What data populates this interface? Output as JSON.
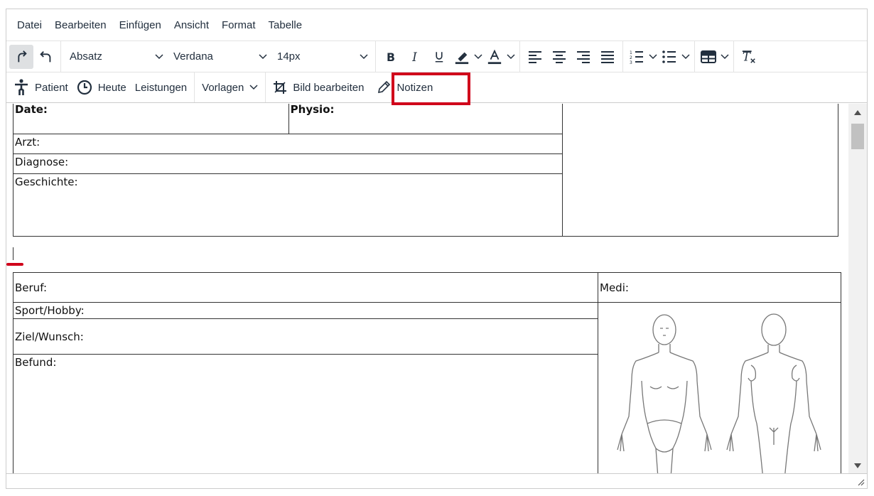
{
  "menubar": {
    "items": [
      "Datei",
      "Bearbeiten",
      "Einfügen",
      "Ansicht",
      "Format",
      "Tabelle"
    ]
  },
  "toolbar1": {
    "block_format": "Absatz",
    "font_family": "Verdana",
    "font_size": "14px",
    "icons": [
      "redo-icon",
      "undo-icon",
      "bold-icon",
      "italic-icon",
      "underline-icon",
      "highlight-icon",
      "text-color-icon",
      "align-left-icon",
      "align-center-icon",
      "align-right-icon",
      "justify-icon",
      "numbered-list-icon",
      "bullet-list-icon",
      "table-icon",
      "clear-format-icon"
    ]
  },
  "toolbar2": {
    "patient": "Patient",
    "heute": "Heute",
    "leistungen": "Leistungen",
    "vorlagen": "Vorlagen",
    "bild_bearbeiten": "Bild bearbeiten",
    "notizen": "Notizen"
  },
  "highlight_color": "#d0021b",
  "document": {
    "table1": {
      "date": "Date:",
      "physio": "Physio:",
      "arzt": "Arzt:",
      "diagnose": "Diagnose:",
      "geschichte": "Geschichte:"
    },
    "table2": {
      "beruf": "Beruf:",
      "medi": "Medi:",
      "sport": "Sport/Hobby:",
      "ziel": "Ziel/Wunsch:",
      "befund": "Befund:"
    }
  }
}
